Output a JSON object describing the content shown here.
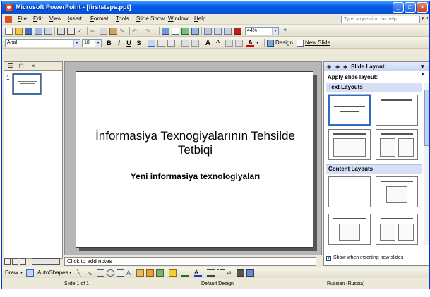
{
  "window": {
    "title": "Microsoft PowerPoint - [firststeps.ppt]"
  },
  "menubar": {
    "items": [
      "File",
      "Edit",
      "View",
      "Insert",
      "Format",
      "Tools",
      "Slide Show",
      "Window",
      "Help"
    ],
    "help_placeholder": "Type a question for help"
  },
  "toolbar_standard": {
    "zoom": "44%"
  },
  "toolbar_formatting": {
    "font": "Arial",
    "font_size": "18",
    "design_label": "Design",
    "new_slide_label": "New Slide"
  },
  "outline_pane": {
    "slide_number": "1"
  },
  "slide": {
    "title": "İnformasiya Texnogiyalarının Tehsilde Tetbiqi",
    "subtitle": "Yeni informasiya texnologiyaları"
  },
  "notes": {
    "placeholder": "Click to add notes"
  },
  "task_pane": {
    "title": "Slide Layout",
    "apply_label": "Apply slide layout:",
    "groups": [
      "Text Layouts",
      "Content Layouts"
    ],
    "footer_label": "Show when inserting new slides",
    "footer_checked": true
  },
  "drawing_toolbar": {
    "draw_label": "Draw",
    "autoshapes_label": "AutoShapes"
  },
  "status_bar": {
    "slide_info": "Slide 1 of 1",
    "design": "Default Design",
    "language": "Russian (Russia)"
  },
  "colors": {
    "titlebar": "#0054e3",
    "chrome": "#ece9d8",
    "selection": "#316ac5"
  }
}
